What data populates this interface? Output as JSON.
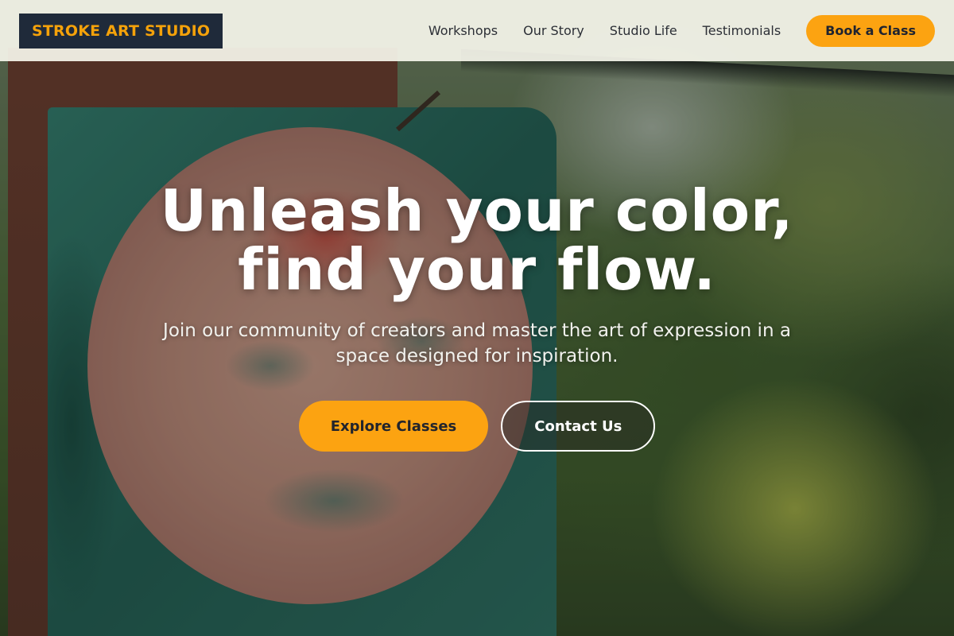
{
  "header": {
    "logo_text": "STROKE ART STUDIO",
    "nav": [
      {
        "label": "Workshops"
      },
      {
        "label": "Our Story"
      },
      {
        "label": "Studio Life"
      },
      {
        "label": "Testimonials"
      }
    ],
    "cta_label": "Book a Class"
  },
  "hero": {
    "title_line1": "Unleash your color,",
    "title_line2": "find your flow.",
    "subtitle": "Join our community of creators and master the art of expression in a space designed for inspiration.",
    "primary_button": "Explore Classes",
    "secondary_button": "Contact Us"
  },
  "colors": {
    "accent": "#fca311",
    "logo_bg": "#1f2a3a",
    "header_bg": "#f5f5eb"
  }
}
